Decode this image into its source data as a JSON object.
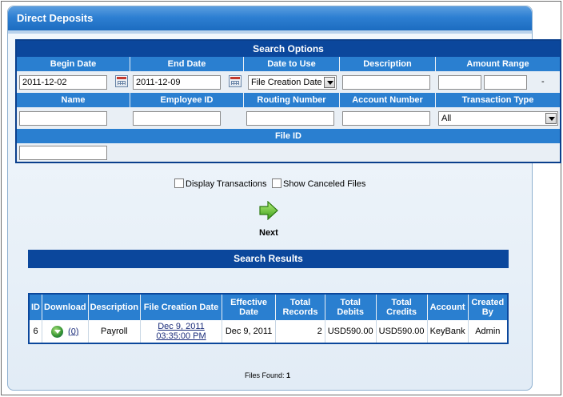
{
  "window": {
    "title": "Direct Deposits"
  },
  "search_options": {
    "title": "Search Options",
    "headers_row1": [
      "Begin Date",
      "End Date",
      "Date to Use",
      "Description",
      "Amount Range"
    ],
    "begin_date": "2011-12-02",
    "end_date": "2011-12-09",
    "date_to_use": "File Creation Date",
    "description": "",
    "amount_min": "",
    "amount_max": "",
    "amount_separator": "-",
    "headers_row2": [
      "Name",
      "Employee ID",
      "Routing Number",
      "Account Number",
      "Transaction Type"
    ],
    "name": "",
    "employee_id": "",
    "routing_number": "",
    "account_number": "",
    "transaction_type": "All",
    "file_id_header": "File ID",
    "file_id": ""
  },
  "options": {
    "display_transactions": "Display Transactions",
    "show_canceled_files": "Show Canceled Files"
  },
  "next_label": "Next",
  "results": {
    "title": "Search Results",
    "columns": [
      "ID",
      "Download",
      "Description",
      "File Creation Date",
      "Effective Date",
      "Total Records",
      "Total Debits",
      "Total Credits",
      "Account",
      "Created By"
    ],
    "rows": [
      {
        "id": "6",
        "download": "(0)",
        "description": "Payroll",
        "file_creation_date_line1": "Dec 9, 2011",
        "file_creation_date_line2": "03:35:00 PM",
        "effective_date": "Dec 9, 2011",
        "total_records": "2",
        "total_debits": "USD590.00",
        "total_credits": "USD590.00",
        "account": "KeyBank",
        "created_by": "Admin"
      }
    ],
    "files_found_label": "Files Found:",
    "files_found_count": "1"
  },
  "colors": {
    "header_dark": "#0b479c",
    "header_light": "#2a7fd0",
    "panel_bg": "#e2ecf6"
  }
}
